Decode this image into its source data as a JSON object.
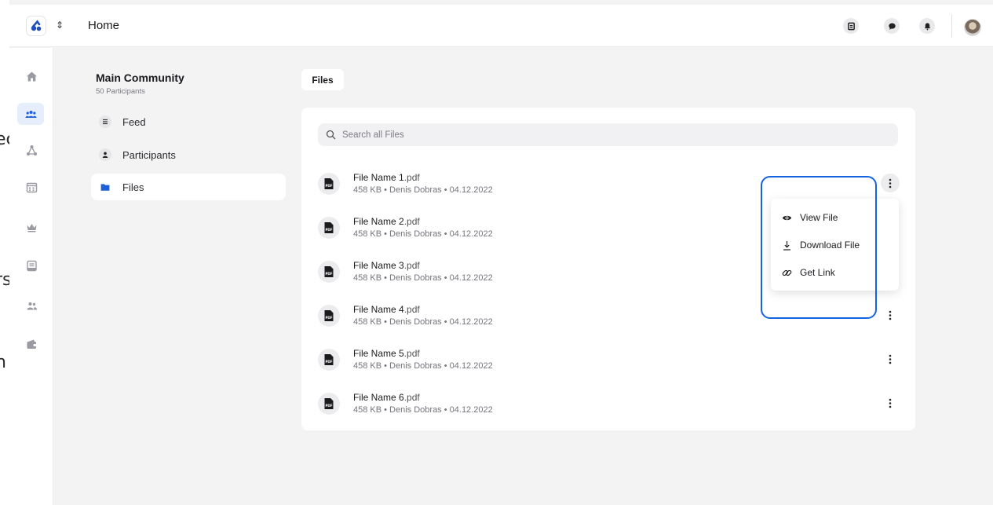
{
  "edge_fragments": [
    "ec",
    "rs",
    "n"
  ],
  "topbar": {
    "title": "Home",
    "switcher_glyph": "⇕",
    "icons": [
      "calendar-ticket-icon",
      "chat-icon",
      "bell-icon"
    ]
  },
  "leftrail": {
    "icons": [
      "home-icon",
      "community-icon",
      "network-icon",
      "calendar-icon",
      "crown-icon",
      "inbox-icon",
      "people-icon",
      "wallet-icon"
    ],
    "active_index": 1
  },
  "community": {
    "title": "Main Community",
    "subtitle": "50 Participants"
  },
  "nav": [
    {
      "label": "Feed",
      "icon": "feed-icon"
    },
    {
      "label": "Participants",
      "icon": "user-icon"
    },
    {
      "label": "Files",
      "icon": "folder-icon",
      "active": true
    }
  ],
  "files_tab": "Files",
  "search": {
    "placeholder": "Search all Files"
  },
  "files": [
    {
      "name": "File Name 1",
      "ext": ".pdf",
      "meta": "458 KB • Denis Dobras • 04.12.2022",
      "menu_open": true
    },
    {
      "name": "File Name 2",
      "ext": ".pdf",
      "meta": "458 KB • Denis Dobras • 04.12.2022"
    },
    {
      "name": "File Name 3",
      "ext": ".pdf",
      "meta": "458 KB • Denis Dobras • 04.12.2022"
    },
    {
      "name": "File Name 4",
      "ext": ".pdf",
      "meta": "458 KB • Denis Dobras • 04.12.2022"
    },
    {
      "name": "File Name 5",
      "ext": ".pdf",
      "meta": "458 KB • Denis Dobras • 04.12.2022"
    },
    {
      "name": "File Name 6",
      "ext": ".pdf",
      "meta": "458 KB • Denis Dobras • 04.12.2022"
    }
  ],
  "file_icon_label": "PDF",
  "context_menu": [
    {
      "label": "View File",
      "icon": "eye-icon"
    },
    {
      "label": "Download File",
      "icon": "download-icon"
    },
    {
      "label": "Get Link",
      "icon": "link-icon"
    }
  ],
  "colors": {
    "accent": "#1463e0",
    "brand": "#1f4fbf",
    "background": "#f3f3f4"
  }
}
